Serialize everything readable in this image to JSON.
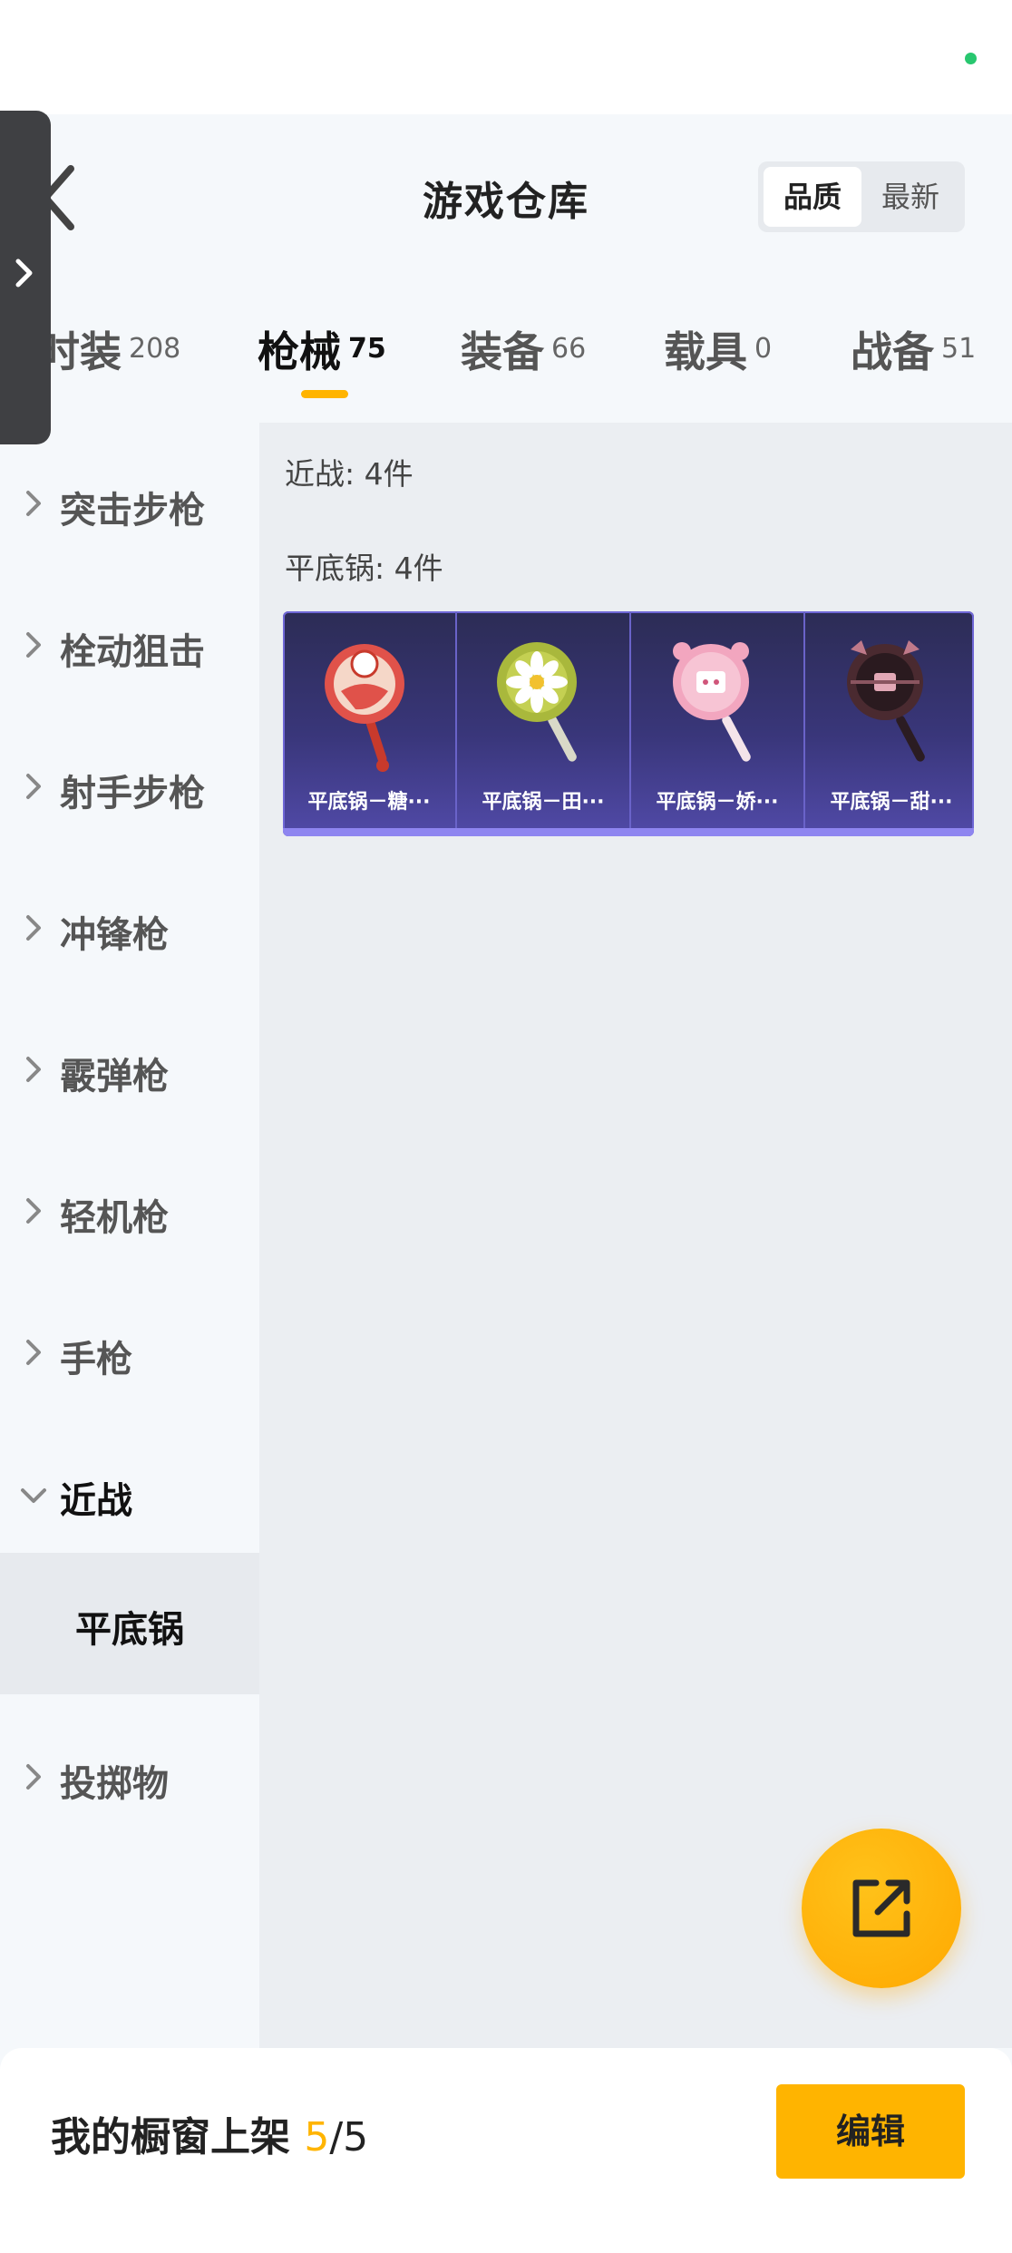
{
  "header": {
    "title": "游戏仓库",
    "sort_options": [
      "品质",
      "最新"
    ],
    "sort_active": "品质"
  },
  "tabs": [
    {
      "label": "时装",
      "count": "208",
      "active": false
    },
    {
      "label": "枪械",
      "count": "75",
      "active": true
    },
    {
      "label": "装备",
      "count": "66",
      "active": false
    },
    {
      "label": "载具",
      "count": "0",
      "active": false
    },
    {
      "label": "战备",
      "count": "51",
      "active": false
    }
  ],
  "sidebar": {
    "categories": [
      {
        "label": "突击步枪"
      },
      {
        "label": "栓动狙击"
      },
      {
        "label": "射手步枪"
      },
      {
        "label": "冲锋枪"
      },
      {
        "label": "霰弹枪"
      },
      {
        "label": "轻机枪"
      },
      {
        "label": "手枪"
      },
      {
        "label": "近战",
        "expanded": true
      },
      {
        "label": "投掷物"
      }
    ],
    "selected_sub": "平底锅"
  },
  "content": {
    "category_summary": "近战: 4件",
    "sub_summary": "平底锅: 4件",
    "items": [
      {
        "label": "平底锅－糖···",
        "icon": "pan-red-icon",
        "color": "#e0524a"
      },
      {
        "label": "平底锅－田···",
        "icon": "pan-daisy-icon",
        "color": "#a9b83c"
      },
      {
        "label": "平底锅－娇···",
        "icon": "pan-pink-icon",
        "color": "#f2a6bf"
      },
      {
        "label": "平底锅－甜···",
        "icon": "pan-dark-icon",
        "color": "#4a2a30"
      }
    ]
  },
  "bottom_bar": {
    "shelf_label": "我的橱窗上架",
    "shelf_count": "5",
    "shelf_total": "/5",
    "edit_label": "编辑"
  },
  "colors": {
    "accent": "#ffb400",
    "status_dot": "#28c76f"
  }
}
